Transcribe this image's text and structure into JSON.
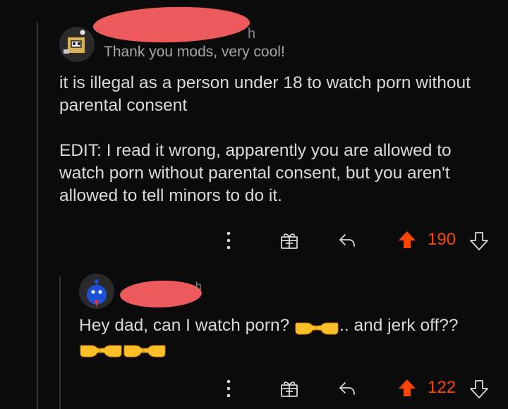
{
  "comments": [
    {
      "author_suffix": "h",
      "flair": "Thank you mods, very cool!",
      "body": [
        "it is illegal as a person under 18 to watch porn without parental consent",
        "EDIT: I read it wrong, apparently you are allowed to watch porn without parental consent, but you aren't allowed to tell minors to do it."
      ],
      "score": "190",
      "icons": {
        "more": "more-vertical-icon",
        "award": "gift-icon",
        "reply": "reply-icon",
        "upvote": "upvote-icon",
        "downvote": "downvote-icon"
      }
    },
    {
      "author_suffix": "h",
      "body_text": "Hey dad, can I watch porn?",
      "body_after": ".. and jerk off??",
      "emojis_inline": [
        "point-right-emoji",
        "point-left-emoji"
      ],
      "emojis_line2": [
        "point-right-emoji",
        "point-left-emoji",
        "point-right-emoji",
        "point-left-emoji"
      ],
      "score": "122",
      "icons": {
        "more": "more-vertical-icon",
        "award": "gift-icon",
        "reply": "reply-icon",
        "upvote": "upvote-icon",
        "downvote": "downvote-icon"
      }
    }
  ],
  "colors": {
    "background": "#0b0b0c",
    "text": "#d7dadc",
    "meta": "#818384",
    "upvote_active": "#ff4500",
    "redaction": "#ec5a5b",
    "thread_line": "#343536"
  }
}
